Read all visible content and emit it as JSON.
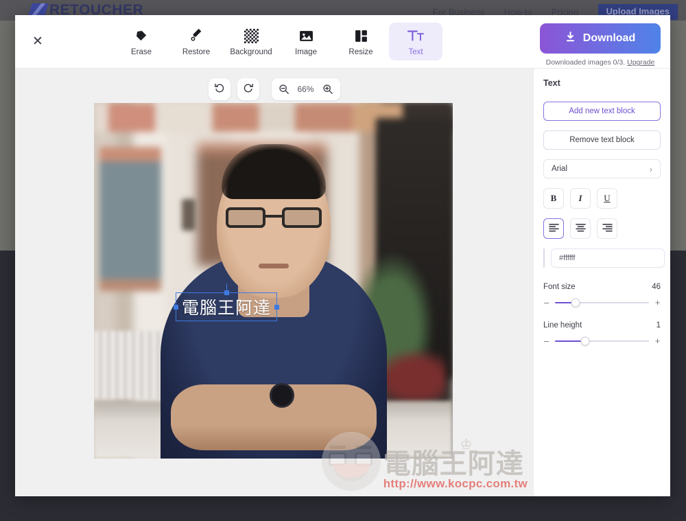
{
  "site": {
    "logo_text": "RETOUCHER",
    "nav": [
      {
        "label": "For Business"
      },
      {
        "label": "How-to"
      },
      {
        "label": "Pricing"
      },
      {
        "label": "Upload Images"
      }
    ]
  },
  "toolbar": {
    "close_label": "✕",
    "tools": [
      {
        "icon": "eraser-icon",
        "label": "Erase",
        "active": false
      },
      {
        "icon": "brush-icon",
        "label": "Restore",
        "active": false
      },
      {
        "icon": "checkered-icon",
        "label": "Background",
        "active": false
      },
      {
        "icon": "image-icon",
        "label": "Image",
        "active": false
      },
      {
        "icon": "resize-icon",
        "label": "Resize",
        "active": false
      },
      {
        "icon": "text-icon",
        "label": "Text",
        "active": true
      }
    ],
    "download_label": "Download",
    "download_icon": "download-icon",
    "download_note_text": "Downloaded images 0/3.",
    "download_note_link": "Upgrade",
    "download_gradient_from": "#8b55d6",
    "download_gradient_to": "#4f83e8"
  },
  "canvas": {
    "undo_icon": "undo-icon",
    "redo_icon": "redo-icon",
    "zoom_out_icon": "zoom-out-icon",
    "zoom_in_icon": "zoom-in-icon",
    "zoom_level": "66%",
    "text_overlay": {
      "value": "電腦王阿達",
      "selected": true
    }
  },
  "watermark": {
    "brand": "電腦王阿達",
    "url": "http://www.kocpc.com.tw",
    "crown_icon": "crown-icon",
    "url_color": "#e05a55"
  },
  "sidebar": {
    "title": "Text",
    "add_block_label": "Add new text block",
    "remove_block_label": "Remove text block",
    "font_family_value": "Arial",
    "chevron_icon": "chevron-right-icon",
    "style_buttons": [
      {
        "name": "bold-button",
        "label": "B"
      },
      {
        "name": "italic-button",
        "label": "I"
      },
      {
        "name": "underline-button",
        "label": "U"
      }
    ],
    "align_buttons": [
      {
        "name": "align-left-button",
        "icon": "align-left-icon",
        "selected": true
      },
      {
        "name": "align-center-button",
        "icon": "align-center-icon",
        "selected": false
      },
      {
        "name": "align-right-button",
        "icon": "align-right-icon",
        "selected": false
      }
    ],
    "color_value": "#ffffff",
    "color_placeholder": "#ffffff",
    "font_size_label": "Font size",
    "font_size_value": "46",
    "font_size_percent": 22,
    "line_height_label": "Line height",
    "line_height_value": "1",
    "line_height_percent": 32,
    "minus_label": "–",
    "plus_label": "+",
    "accent": "#6d4fd0"
  }
}
